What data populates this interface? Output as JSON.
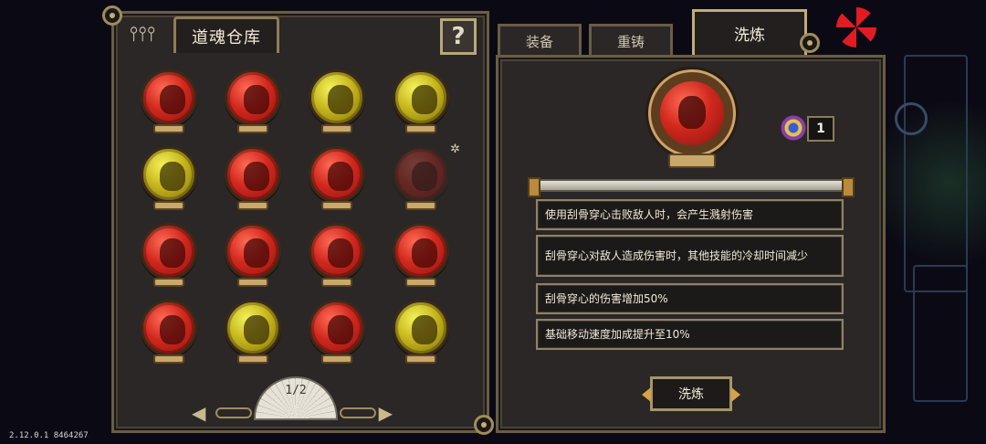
{
  "storage": {
    "title": "道魂仓库",
    "help_glyph": "?",
    "page_label": "1/2",
    "prev_glyph": "◀",
    "next_glyph": "▶",
    "orbs": [
      {
        "color": "red",
        "icon": "demon-face-icon"
      },
      {
        "color": "red",
        "icon": "warrior-face-icon"
      },
      {
        "color": "yellow",
        "icon": "bandana-face-icon"
      },
      {
        "color": "yellow",
        "icon": "maiden-face-icon"
      },
      {
        "color": "yellow",
        "icon": "skull-mask-icon"
      },
      {
        "color": "red",
        "icon": "general-face-icon"
      },
      {
        "color": "red",
        "icon": "helmet-face-icon"
      },
      {
        "color": "red",
        "icon": "lady-face-icon",
        "faded": true,
        "starred": true
      },
      {
        "color": "red",
        "icon": "girl-face-icon"
      },
      {
        "color": "red",
        "icon": "monk-face-icon"
      },
      {
        "color": "red",
        "icon": "elf-face-icon"
      },
      {
        "color": "red",
        "icon": "beast-face-icon"
      },
      {
        "color": "red",
        "icon": "armor-face-icon"
      },
      {
        "color": "yellow",
        "icon": "ninja-face-icon"
      },
      {
        "color": "red",
        "icon": "dancer-face-icon"
      },
      {
        "color": "yellow",
        "icon": "jester-face-icon"
      }
    ]
  },
  "tabs": {
    "equip": "装备",
    "reforge": "重铸",
    "refine": "洗炼"
  },
  "detail": {
    "orb_icon": "buns-girl-face-icon",
    "material_icon": "eye-gem-icon",
    "material_count": "1",
    "affixes": [
      "使用刮骨穿心击败敌人时，会产生溅射伤害",
      "刮骨穿心对敌人造成伤害时，其他技能的冷却时间减少",
      "刮骨穿心的伤害增加50%",
      "基础移动速度加成提升至10%"
    ],
    "refine_button": "洗炼"
  },
  "version": "2.12.0.1 8464267",
  "colors": {
    "orb_red": "#d1281d",
    "orb_yellow": "#c7b51d",
    "panel": "#2a2726",
    "border_gold": "#a6946a"
  }
}
